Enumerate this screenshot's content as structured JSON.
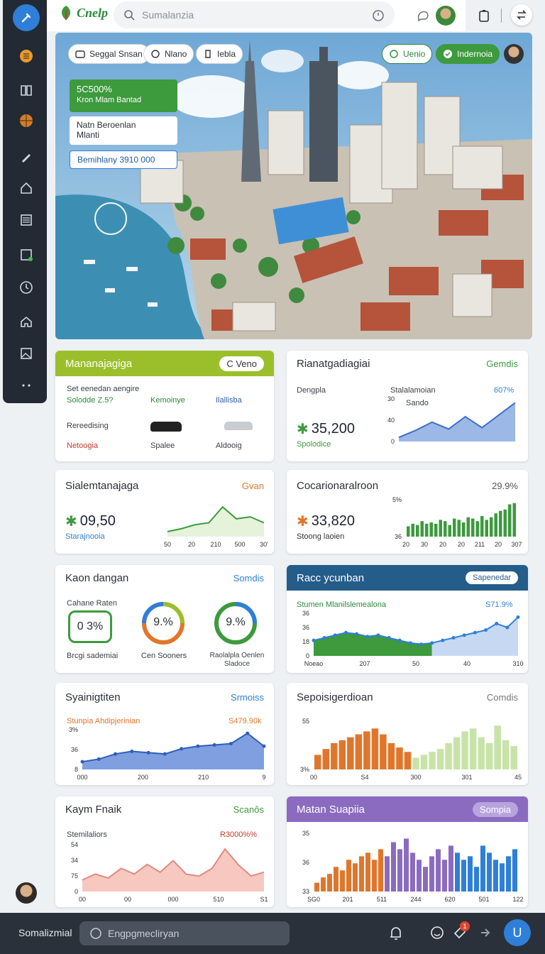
{
  "colors": {
    "sidebar": "#232a34",
    "accent_blue": "#2f7fd8",
    "green": "#3d9a3d",
    "lime": "#9bbf2a",
    "orange": "#e0762b",
    "purple": "#8b6bc0",
    "navy": "#245c8a"
  },
  "topbar": {
    "brand": "Cnelp",
    "search_placeholder": "Sumalanzia"
  },
  "hero": {
    "chips": [
      "Seggal Snsan",
      "Nlano",
      "Iebla"
    ],
    "right_chips": [
      "Uenio",
      "Indernoia"
    ],
    "stat": {
      "value": "5C500%",
      "label": "Kron Mlam Bantad"
    },
    "info": {
      "line1": "Natn Beroenlan",
      "line2": "Mlanti"
    },
    "bar": "Bemihlany 3910 000"
  },
  "cards": {
    "c1": {
      "title": "Mananajagiga",
      "action": "C Veno",
      "subtitle": "Set eenedan aengire",
      "row1": [
        "Solodde",
        "Kemoinye",
        "Ilallisba"
      ],
      "row1_num": "Z.5?",
      "row2": [
        "Rereedising"
      ],
      "row3": [
        "Netoogia",
        "Spalee",
        "Aldooig"
      ]
    },
    "c2": {
      "title": "Rianatgadiagiai",
      "action": "Gemdis",
      "label": "Dengpla",
      "series": "Stalalamoian",
      "legend": "Sando",
      "percent": "607%",
      "value": "35,200",
      "value_sub": "Spolodice"
    },
    "c3": {
      "title": "Sialemtanajaga",
      "action": "Gvan",
      "value": "09,50",
      "value_sub": "Starajnooia"
    },
    "c4": {
      "title": "Cocarionaralroon",
      "action": "29.9%",
      "value": "33,820",
      "value_sub": "Stoong laoien"
    },
    "c5": {
      "title": "Kaon dangan",
      "action": "Somdis",
      "items": [
        {
          "label": "Cahane Raten",
          "value": "0 3%",
          "caption": "Brcgi sademiai"
        },
        {
          "value": "9.%",
          "caption": "Cen Sooners"
        },
        {
          "value": "9.%",
          "caption": "Raolalpla Oenlen Sladoce"
        }
      ]
    },
    "c6": {
      "title": "Racc ycunban",
      "action": "Sapenedar",
      "series": "Stumen Mlanilslemealona",
      "percent": "S71.9%"
    },
    "c7": {
      "title": "Syainigtiten",
      "action": "Srmoiss",
      "series": "Stunpia Ahdipjerinian",
      "percent": "S479.90k"
    },
    "c8": {
      "title": "Sepoisigerdioan",
      "action": "Comdis"
    },
    "c9": {
      "title": "Kaym Fnaik",
      "action": "Scanôs",
      "series": "Stemilaliors",
      "percent": "R3000%%"
    },
    "c10": {
      "title": "Matan Suapiia",
      "action": "Sompia"
    }
  },
  "chart_data": [
    {
      "type": "area",
      "title": "Stalalamoian",
      "categories": [
        "1",
        "2",
        "3",
        "4",
        "5",
        "6",
        "7",
        "8"
      ],
      "values": [
        3,
        8,
        14,
        9,
        18,
        10,
        19,
        28
      ],
      "yticks": [
        "0",
        "40",
        "30"
      ]
    },
    {
      "type": "line",
      "title": "",
      "xticks": [
        "50",
        "20",
        "210",
        "500",
        "30'"
      ],
      "values": [
        5,
        8,
        12,
        14,
        30,
        18,
        20,
        14
      ]
    },
    {
      "type": "bar",
      "title": "",
      "xticks": [
        "20",
        "30",
        "20",
        "20",
        "211",
        "20",
        "307"
      ],
      "values": [
        8,
        10,
        9,
        12,
        10,
        11,
        10,
        13,
        12,
        9,
        14,
        13,
        11,
        15,
        14,
        12,
        16,
        13,
        15,
        18,
        20,
        21,
        25,
        26
      ],
      "yticks": [
        "36",
        "5%"
      ]
    },
    {
      "type": "area",
      "title": "Stumen Mlanilslemealona",
      "xticks": [
        "Noeao",
        "207",
        "50",
        "40",
        "310"
      ],
      "values": [
        12,
        14,
        16,
        18,
        17,
        15,
        16,
        14,
        12,
        10,
        9,
        10,
        12,
        14,
        16,
        18,
        20,
        25,
        22,
        30
      ],
      "yticks": [
        "0",
        "18",
        "36",
        "36"
      ]
    },
    {
      "type": "area",
      "title": "Stunpia Ahdipjerinian",
      "xticks": [
        "000",
        "200",
        "210",
        "9"
      ],
      "values": [
        6,
        8,
        12,
        14,
        13,
        12,
        16,
        18,
        19,
        20,
        28,
        18
      ],
      "yticks": [
        "8",
        "36",
        "3%"
      ]
    },
    {
      "type": "bar",
      "title": "",
      "xticks": [
        "00",
        "S4",
        "300",
        "301",
        "45"
      ],
      "values": [
        10,
        14,
        18,
        20,
        22,
        24,
        26,
        28,
        24,
        18,
        15,
        12,
        8,
        10,
        12,
        14,
        18,
        22,
        26,
        28,
        22,
        18,
        30,
        20,
        16
      ],
      "yticks": [
        "3%",
        "55"
      ]
    },
    {
      "type": "area",
      "title": "Stemilaliors",
      "xticks": [
        "00",
        "00",
        "000",
        "510",
        "S1"
      ],
      "values": [
        6,
        9,
        7,
        12,
        9,
        14,
        10,
        16,
        9,
        8,
        12,
        22,
        14,
        8,
        10
      ],
      "yticks": [
        "0",
        "75",
        "34",
        "54"
      ]
    },
    {
      "type": "bar",
      "title": "",
      "xticks": [
        "SG0",
        "201",
        "511",
        "244",
        "620",
        "501",
        "122"
      ],
      "values": [
        5,
        8,
        10,
        14,
        12,
        18,
        16,
        20,
        22,
        18,
        24,
        20,
        28,
        24,
        30,
        22,
        18,
        14,
        20,
        24,
        18,
        26,
        22,
        18,
        20,
        14,
        26,
        22,
        18,
        16,
        20,
        24
      ],
      "yticks": [
        "33",
        "36",
        "35"
      ]
    }
  ],
  "bottombar": {
    "app_title": "Somalizmial",
    "input": "Engpgmecliryan",
    "badge": "1",
    "user_initial": "U"
  }
}
